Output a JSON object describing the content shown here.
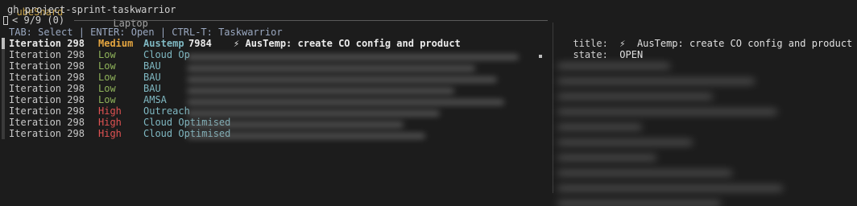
{
  "terminal": {
    "top_fragment_left": "ubeSnard",
    "top_fragment_right": "Laptop",
    "command": "gh project-sprint-taskwarrior",
    "prompt_char": "<",
    "match_count": "9/9 (0)",
    "help_line": "TAB: Select | ENTER: Open | CTRL-T: Taskwarrior"
  },
  "tasks": [
    {
      "iteration": "Iteration 298",
      "priority": "Medium",
      "priority_class": "medium",
      "project": "Austemp",
      "id": "7984",
      "icon": "⚡",
      "title": "AusTemp: create CO config and product",
      "selected": true
    },
    {
      "iteration": "Iteration 298",
      "priority": "Low",
      "priority_class": "low",
      "project": "Cloud Op",
      "id": "",
      "icon": "",
      "title": "",
      "selected": false
    },
    {
      "iteration": "Iteration 298",
      "priority": "Low",
      "priority_class": "low",
      "project": "BAU",
      "id": "",
      "icon": "",
      "title": "",
      "selected": false
    },
    {
      "iteration": "Iteration 298",
      "priority": "Low",
      "priority_class": "low",
      "project": "BAU",
      "id": "",
      "icon": "",
      "title": "",
      "selected": false
    },
    {
      "iteration": "Iteration 298",
      "priority": "Low",
      "priority_class": "low",
      "project": "BAU",
      "id": "",
      "icon": "",
      "title": "",
      "selected": false
    },
    {
      "iteration": "Iteration 298",
      "priority": "Low",
      "priority_class": "low",
      "project": "AMSA",
      "id": "",
      "icon": "",
      "title": "",
      "selected": false
    },
    {
      "iteration": "Iteration 298",
      "priority": "High",
      "priority_class": "high",
      "project": "Outreach",
      "id": "",
      "icon": "",
      "title": "",
      "selected": false
    },
    {
      "iteration": "Iteration 298",
      "priority": "High",
      "priority_class": "high",
      "project": "Cloud Optimised",
      "id": "",
      "icon": "",
      "title": "",
      "selected": false
    },
    {
      "iteration": "Iteration 298",
      "priority": "High",
      "priority_class": "high",
      "project": "Cloud Optimised",
      "id": "",
      "icon": "",
      "title": "",
      "selected": false
    }
  ],
  "preview": {
    "title_label": "title:",
    "title_icon": "⚡",
    "title_value": "AusTemp: create CO config and product",
    "state_label": "state:",
    "state_value": "OPEN"
  },
  "colors": {
    "background": "#1c1c1c",
    "priority_medium": "#e5a640",
    "priority_low": "#8fb35a",
    "priority_high": "#e05252",
    "project": "#7fb8c2",
    "help": "#9aa8c0"
  }
}
